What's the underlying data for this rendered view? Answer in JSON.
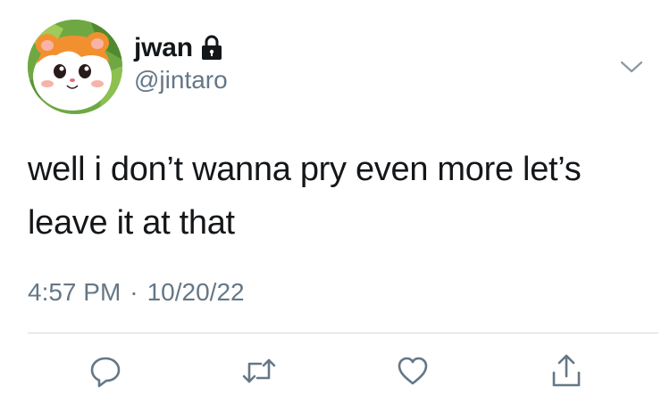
{
  "tweet": {
    "author": {
      "display_name": "jwan",
      "handle": "@jintaro",
      "protected_icon": "lock-icon",
      "avatar_icon": "hamster-avatar"
    },
    "text": "well i don’t wanna pry even more let’s\nleave it at that",
    "time": "4:57 PM",
    "separator": "·",
    "date": "10/20/22",
    "menu_icon": "chevron-down-icon",
    "actions": {
      "reply_icon": "reply-icon",
      "retweet_icon": "retweet-icon",
      "like_icon": "heart-icon",
      "share_icon": "share-icon"
    }
  },
  "colors": {
    "text_primary": "#14171a",
    "text_secondary": "#657786",
    "icon": "#657786",
    "divider": "#d6dbdf"
  }
}
